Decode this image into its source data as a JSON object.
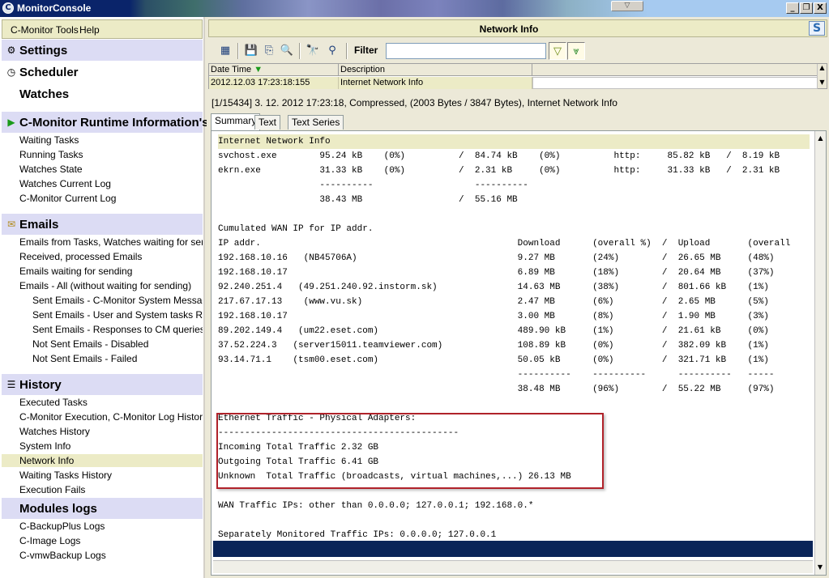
{
  "window": {
    "title": "MonitorConsole",
    "app_icon": "C",
    "grip": "▽",
    "controls": {
      "minimize": "_",
      "restore": "❐",
      "close": "X"
    }
  },
  "sidebar": {
    "menu": {
      "tools": "C-Monitor Tools",
      "help": "Help"
    },
    "settings": "Settings",
    "scheduler": "Scheduler",
    "watches": "Watches",
    "runtime": {
      "title": "C-Monitor Runtime Information's",
      "items": [
        "Waiting Tasks",
        "Running Tasks",
        "Watches State",
        "Watches Current Log",
        "C-Monitor Current Log"
      ]
    },
    "emails": {
      "title": "Emails",
      "items": [
        "Emails from Tasks, Watches waiting for sending",
        "Received, processed Emails",
        "Emails waiting for sending",
        "Emails - All (without waiting for sending)"
      ],
      "subitems": [
        "Sent Emails - C-Monitor System Messages",
        "Sent Emails - User and System tasks Results",
        "Sent Emails - Responses to CM queries",
        "Not Sent Emails - Disabled",
        "Not Sent Emails - Failed"
      ]
    },
    "history": {
      "title": "History",
      "items": [
        "Executed Tasks",
        "C-Monitor Execution, C-Monitor Log History",
        "Watches History",
        "System Info",
        "Network Info",
        "Waiting Tasks History",
        "Execution Fails"
      ],
      "selected_index": 4
    },
    "modules": {
      "title": "Modules logs",
      "items": [
        "C-BackupPlus Logs",
        "C-Image Logs",
        "C-vmwBackup Logs"
      ]
    }
  },
  "main": {
    "header_title": "Network Info",
    "logo": "S",
    "toolbar": {
      "filter_label": "Filter",
      "filter_value": ""
    },
    "grid": {
      "columns": [
        "Date Time",
        "Description"
      ],
      "row": {
        "datetime": "2012.12.03   17:23:18:155",
        "description": "Internet Network Info"
      }
    },
    "info_line": "[1/15434]  3. 12. 2012 17:23:18, Compressed, (2003 Bytes / 3847 Bytes), Internet Network Info",
    "tabs": [
      "Summary",
      "Text",
      "Text Series"
    ],
    "active_tab": 0,
    "report_lines": [
      "Internet Network Info",
      "svchost.exe        95.24 kB    (0%)          /  84.74 kB    (0%)          http:     85.82 kB   /  8.19 kB",
      "ekrn.exe           31.33 kB    (0%)          /  2.31 kB     (0%)          http:     31.33 kB   /  2.31 kB",
      "                   ----------                   ----------",
      "                   38.43 MB                  /  55.16 MB",
      "",
      "Cumulated WAN IP for IP addr.",
      "IP addr.                                                Download      (overall %)  /  Upload       (overall",
      "192.168.10.16   (NB45706A)                              9.27 MB       (24%)        /  26.65 MB     (48%)",
      "192.168.10.17                                           6.89 MB       (18%)        /  20.64 MB     (37%)",
      "92.240.251.4   (49.251.240.92.instorm.sk)               14.63 MB      (38%)        /  801.66 kB    (1%)",
      "217.67.17.13    (www.vu.sk)                             2.47 MB       (6%)         /  2.65 MB      (5%)",
      "192.168.10.17                                           3.00 MB       (8%)         /  1.90 MB      (3%)",
      "89.202.149.4   (um22.eset.com)                          489.90 kB     (1%)         /  21.61 kB     (0%)",
      "37.52.224.3   (server15011.teamviewer.com)              108.89 kB     (0%)         /  382.09 kB    (1%)",
      "93.14.71.1    (tsm00.eset.com)                          50.05 kB      (0%)         /  321.71 kB    (1%)",
      "                                                        ----------    ----------      ----------   -----",
      "                                                        38.48 MB      (96%)        /  55.22 MB     (97%)",
      "",
      "Ethernet Traffic - Physical Adapters:",
      "---------------------------------------------",
      "Incoming Total Traffic 2.32 GB",
      "Outgoing Total Traffic 6.41 GB",
      "Unknown  Total Traffic (broadcasts, virtual machines,...) 26.13 MB",
      "",
      "WAN Traffic IPs: other than 0.0.0.0; 127.0.0.1; 192.168.0.*",
      "",
      "Separately Monitored Traffic IPs: 0.0.0.0; 127.0.0.1"
    ],
    "colors": {
      "highlight_border": "#b0222a",
      "sidebar_section": "#dcdcf4",
      "selected": "#ecebc6"
    }
  }
}
